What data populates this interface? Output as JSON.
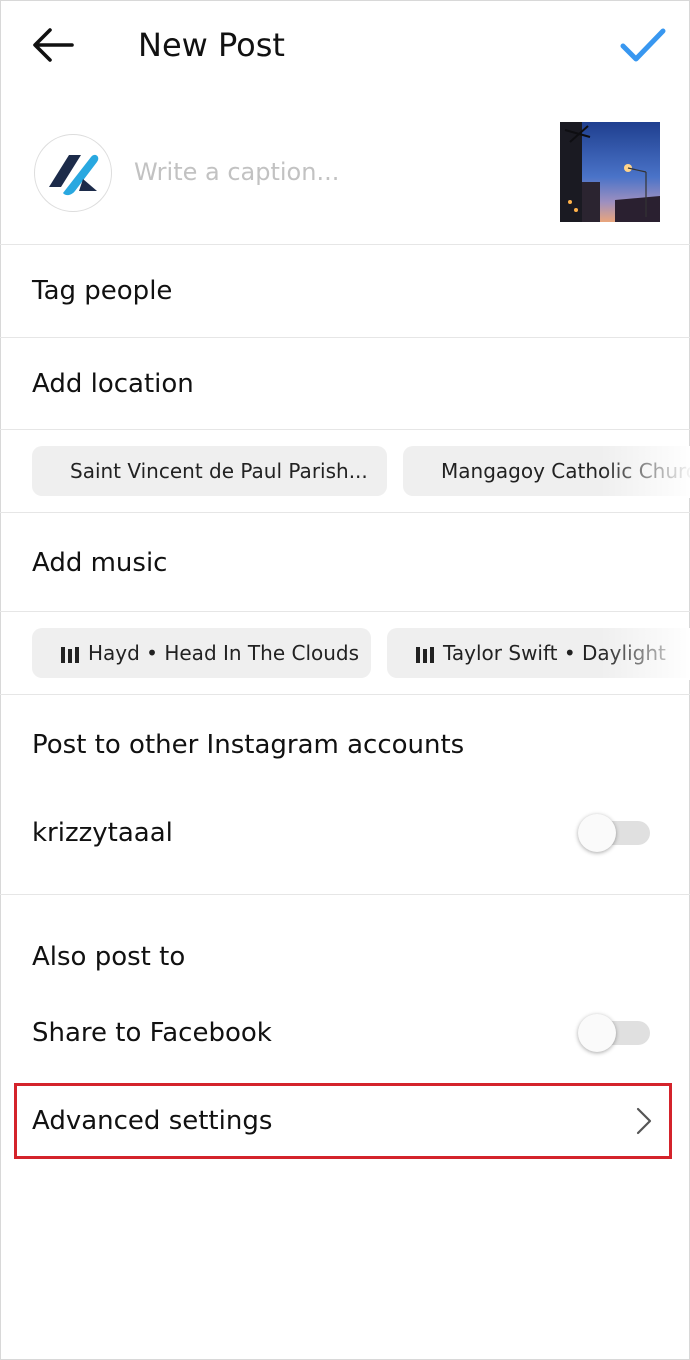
{
  "header": {
    "title": "New Post",
    "back_icon": "back-arrow-icon",
    "confirm_icon": "checkmark-icon",
    "accent_color": "#3897f0"
  },
  "caption": {
    "placeholder": "Write a caption...",
    "value": ""
  },
  "options": {
    "tag_people": "Tag people",
    "add_location": "Add location",
    "location_suggestions": [
      "Saint Vincent de Paul Parish...",
      "Mangagoy  Catholic Church"
    ],
    "add_music": "Add music",
    "music_suggestions": [
      "Hayd • Head In The Clouds",
      "Taylor Swift • Daylight"
    ]
  },
  "other_accounts": {
    "heading": "Post to other Instagram accounts",
    "account_name": "krizzytaaal",
    "enabled": false
  },
  "also_post": {
    "heading": "Also post to",
    "facebook_label": "Share to Facebook",
    "enabled": false
  },
  "advanced": {
    "label": "Advanced settings",
    "highlight_color": "#d4232b"
  }
}
